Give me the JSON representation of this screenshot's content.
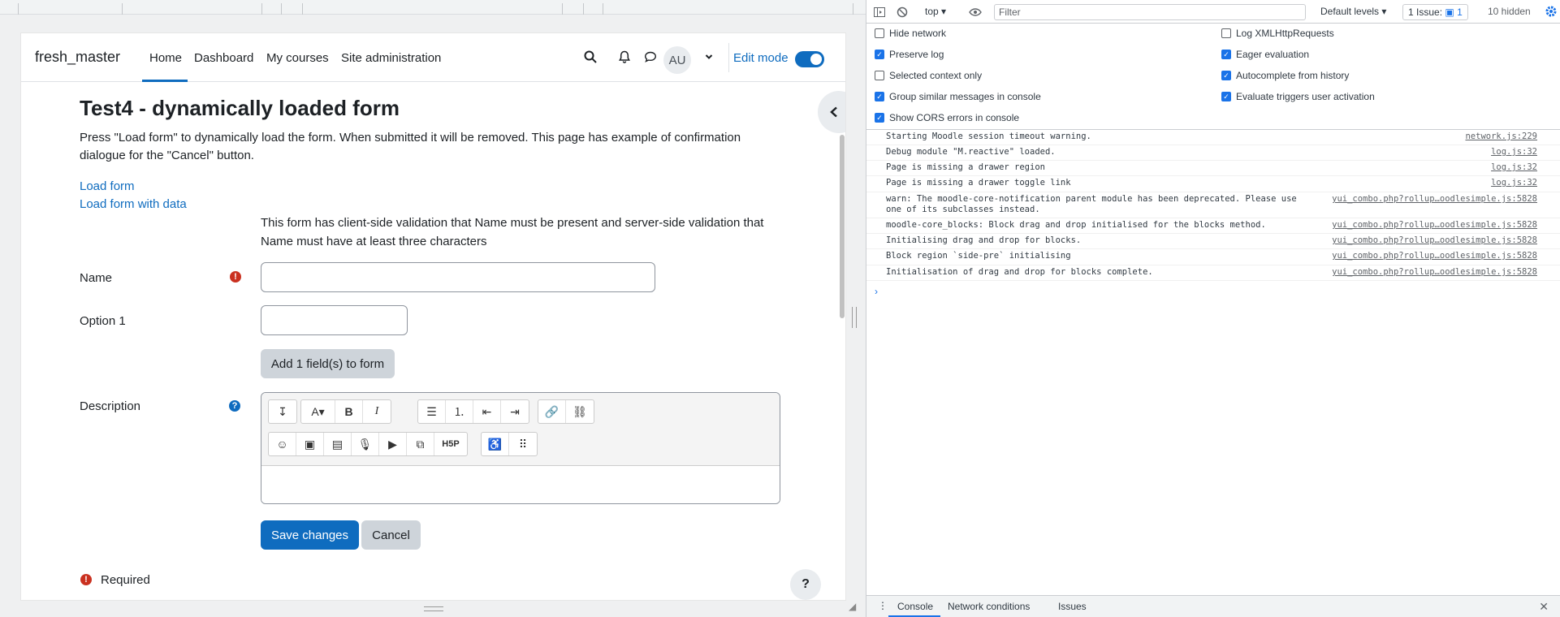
{
  "site": {
    "brand": "fresh_master",
    "nav": [
      "Home",
      "Dashboard",
      "My courses",
      "Site administration"
    ],
    "avatar_initials": "AU",
    "edit_mode_label": "Edit mode"
  },
  "page": {
    "title": "Test4 - dynamically loaded form",
    "intro": "Press \"Load form\" to dynamically load the form. When submitted it will be removed. This page has example of confirmation dialogue for the \"Cancel\" button.",
    "links": [
      "Load form",
      "Load form with data"
    ],
    "form_note": "This form has client-side validation that Name must be present and server-side validation that Name must have at least three characters"
  },
  "form": {
    "name_label": "Name",
    "option1_label": "Option 1",
    "add_field_label": "Add 1 field(s) to form",
    "description_label": "Description",
    "save_label": "Save changes",
    "cancel_label": "Cancel",
    "required_label": "Required",
    "help_fab": "?"
  },
  "editor": {
    "toolbar_row1": [
      "↧",
      "A▾",
      "B",
      "I",
      "☰",
      "⒈",
      "⇤",
      "⇥",
      "🔗",
      "⛓"
    ],
    "toolbar_row2": [
      "☺",
      "▣",
      "▤",
      "🎙",
      "▶",
      "⧉",
      "H5P",
      "♿",
      "⠿"
    ]
  },
  "devtools": {
    "context": "top ▾",
    "filter_placeholder": "Filter",
    "levels": "Default levels ▾",
    "issues_text": "1 Issue:",
    "issues_count": "1",
    "hidden_text": "10 hidden",
    "settings_left": [
      {
        "label": "Hide network",
        "checked": false
      },
      {
        "label": "Preserve log",
        "checked": true
      },
      {
        "label": "Selected context only",
        "checked": false
      },
      {
        "label": "Group similar messages in console",
        "checked": true
      },
      {
        "label": "Show CORS errors in console",
        "checked": true
      }
    ],
    "settings_right": [
      {
        "label": "Log XMLHttpRequests",
        "checked": false
      },
      {
        "label": "Eager evaluation",
        "checked": true
      },
      {
        "label": "Autocomplete from history",
        "checked": true
      },
      {
        "label": "Evaluate triggers user activation",
        "checked": true
      }
    ],
    "messages": [
      {
        "text": "Starting Moodle session timeout warning.",
        "source": "network.js:229"
      },
      {
        "text": "Debug module \"M.reactive\" loaded.",
        "source": "log.js:32"
      },
      {
        "text": "Page is missing a drawer region",
        "source": "log.js:32"
      },
      {
        "text": "Page is missing a drawer toggle link",
        "source": "log.js:32"
      },
      {
        "text": "warn: The moodle-core-notification parent module has been deprecated. Please use one of its subclasses instead.",
        "source": "yui_combo.php?rollup…oodlesimple.js:5828"
      },
      {
        "text": "moodle-core_blocks: Block drag and drop initialised for the blocks method.",
        "source": "yui_combo.php?rollup…oodlesimple.js:5828"
      },
      {
        "text": "Initialising drag and drop for blocks.",
        "source": "yui_combo.php?rollup…oodlesimple.js:5828"
      },
      {
        "text": "Block region `side-pre` initialising",
        "source": "yui_combo.php?rollup…oodlesimple.js:5828"
      },
      {
        "text": "Initialisation of drag and drop for blocks complete.",
        "source": "yui_combo.php?rollup…oodlesimple.js:5828"
      }
    ],
    "prompt": "›",
    "drawer_tabs": [
      "Console",
      "Network conditions",
      "Issues"
    ]
  },
  "colors": {
    "primary": "#0f6cbf",
    "error": "#ca3120",
    "devtools_accent": "#1a73e8"
  }
}
